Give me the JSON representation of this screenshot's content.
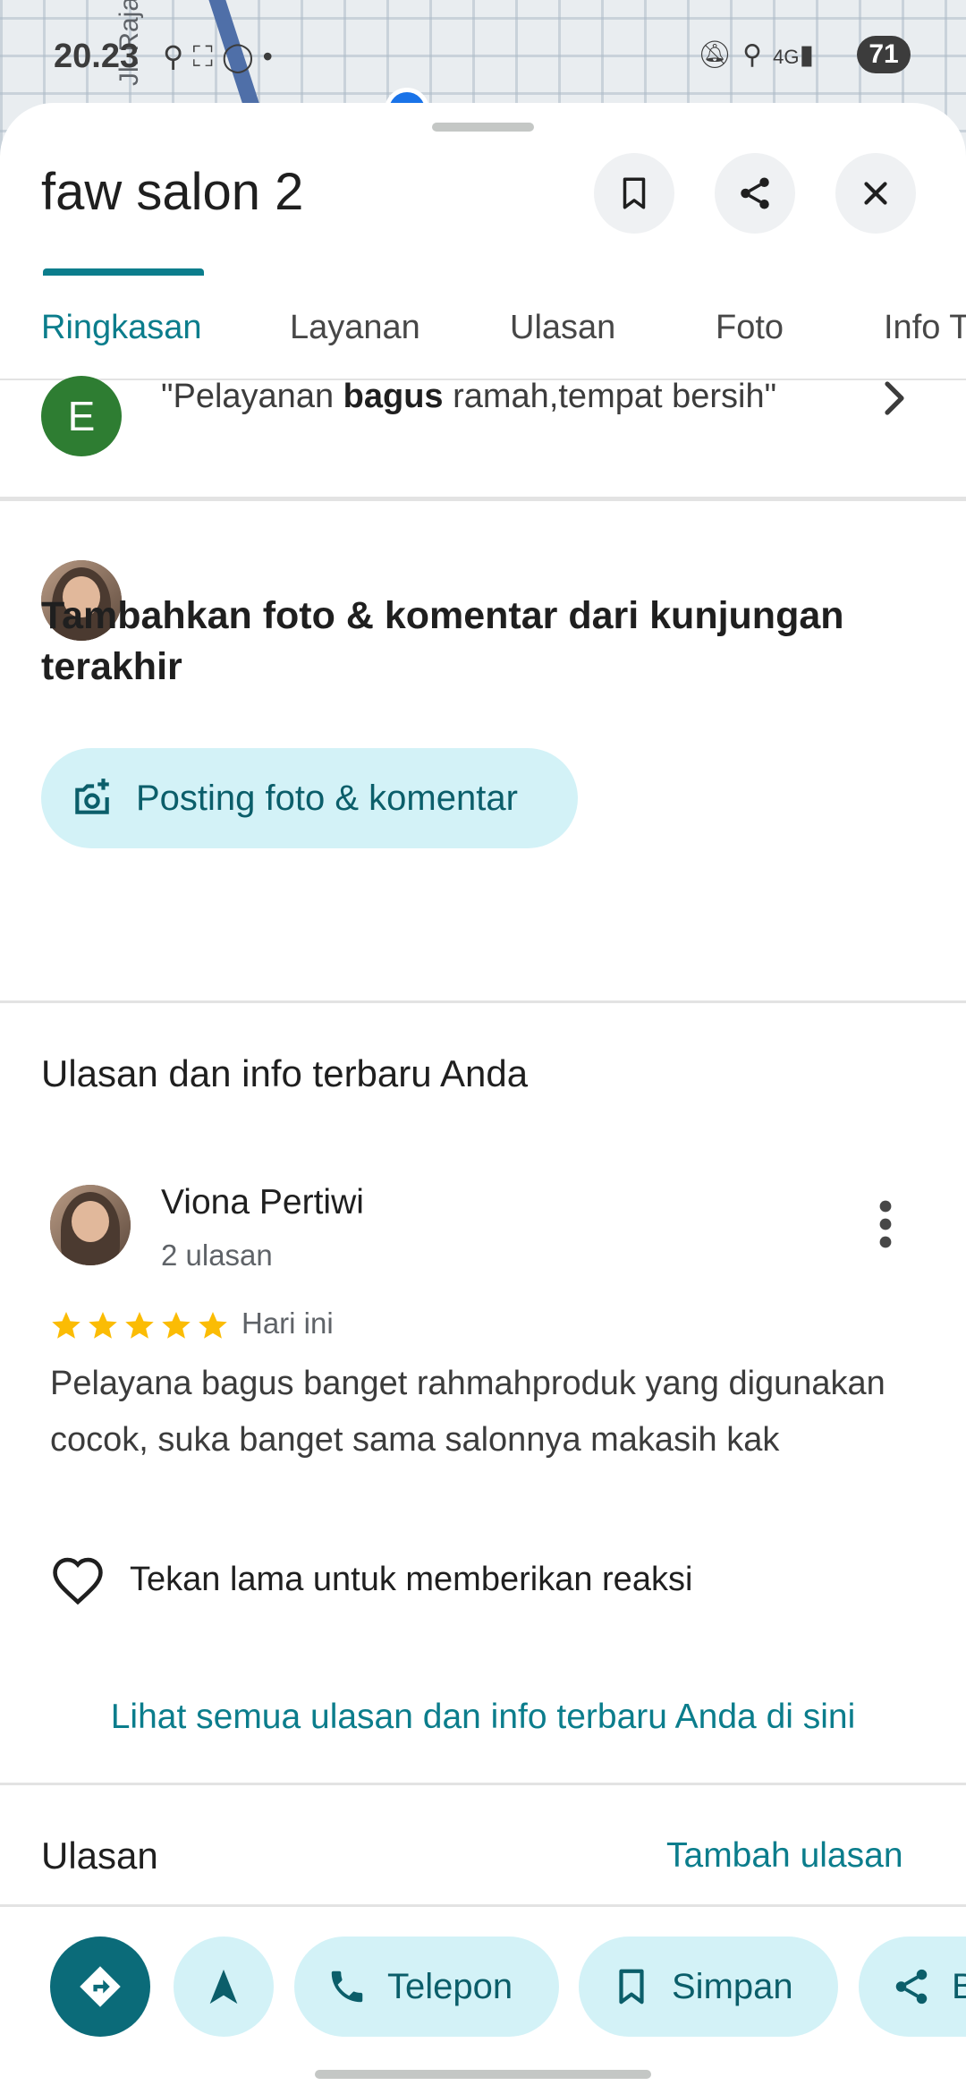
{
  "status_bar": {
    "time": "20.23",
    "battery": "71",
    "network": "4G"
  },
  "map": {
    "street_label": "Jl. Raja"
  },
  "place": {
    "name": "faw salon 2"
  },
  "tabs": [
    {
      "label": "Ringkasan",
      "active": true
    },
    {
      "label": "Layanan",
      "active": false
    },
    {
      "label": "Ulasan",
      "active": false
    },
    {
      "label": "Foto",
      "active": false
    },
    {
      "label": "Info T",
      "active": false
    }
  ],
  "review_snippet": {
    "avatar_letter": "E",
    "text_before": "\"Pelayanan ",
    "text_bold": "bagus",
    "text_after": " ramah,tempat bersih\""
  },
  "add_photo": {
    "title": "Tambahkan foto & komentar dari kunjungan terakhir",
    "button_label": "Posting foto & komentar"
  },
  "your_reviews": {
    "heading": "Ulasan dan info terbaru Anda",
    "reviewer_name": "Viona Pertiwi",
    "review_count": "2 ulasan",
    "rating": 5,
    "date": "Hari ini",
    "text": "Pelayana bagus banget rahmahproduk yang digunakan cocok, suka banget sama salonnya makasih kak",
    "reaction_hint": "Tekan lama untuk memberikan reaksi",
    "see_all_link": "Lihat semua ulasan dan info terbaru Anda di sini"
  },
  "reviews_section": {
    "heading": "Ulasan",
    "add_link": "Tambah ulasan"
  },
  "actions": {
    "call": "Telepon",
    "save": "Simpan",
    "share": "Bagikan"
  },
  "colors": {
    "accent": "#0b7d8c",
    "chip_bg": "#d3f2f7",
    "star": "#fbbc04",
    "avatar_e": "#2e7d32"
  }
}
